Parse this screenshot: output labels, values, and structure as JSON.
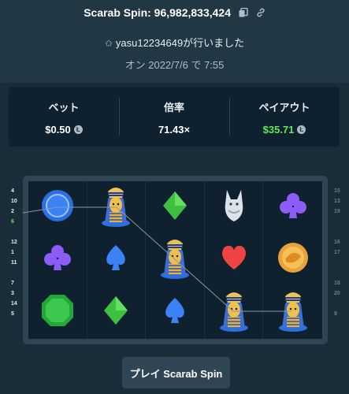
{
  "header": {
    "title": "Scarab Spin: 96,982,833,424",
    "user_text": "yasu12234649が行いました",
    "date_text": "オン 2022/7/6 で 7:55"
  },
  "stats": {
    "bet_label": "ベット",
    "bet_value": "$0.50",
    "multiplier_label": "倍率",
    "multiplier_value": "71.43×",
    "payout_label": "ペイアウト",
    "payout_value": "$35.71"
  },
  "line_numbers": {
    "left": [
      "4",
      "10",
      "2",
      "6",
      "",
      "12",
      "1",
      "11",
      "",
      "7",
      "3",
      "14",
      "5"
    ],
    "left_highlight": "6",
    "right": [
      "15",
      "13",
      "19",
      "",
      "",
      "16",
      "17",
      "",
      "",
      "18",
      "20",
      "",
      "9"
    ]
  },
  "grid": [
    [
      "blue-coin-icon",
      "pharaoh-icon",
      "green-diamond-icon",
      "wolf-icon",
      "purple-club-icon"
    ],
    [
      "purple-club-icon",
      "blue-spade-icon",
      "pharaoh-icon",
      "red-heart-icon",
      "gold-scarab-coin-icon"
    ],
    [
      "green-gem-icon",
      "green-diamond-icon",
      "blue-spade-icon",
      "pharaoh-icon",
      "pharaoh-icon"
    ]
  ],
  "colors": {
    "background": "#1a2c38",
    "panel": "#0f212e",
    "payout_green": "#5ee85e",
    "accent_blue": "#3b82f6"
  },
  "play_button": {
    "label": "プレイ Scarab Spin"
  }
}
